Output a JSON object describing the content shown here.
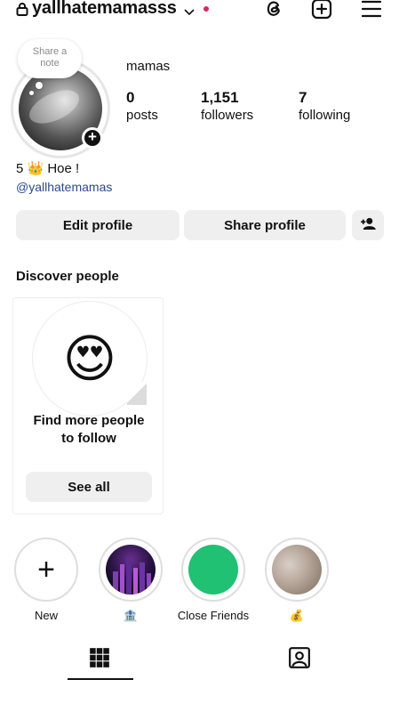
{
  "header": {
    "username": "yallhatemamasss",
    "icons": [
      "lock-icon",
      "chevron-down-icon",
      "threads-icon",
      "new-post-icon",
      "menu-icon"
    ],
    "notification_dot_color": "#e0245e"
  },
  "profile": {
    "note_placeholder_line1": "Share a",
    "note_placeholder_line2": "note",
    "display_name": "mamas",
    "stats": [
      {
        "number": "0",
        "label": "posts"
      },
      {
        "number": "1,151",
        "label": "followers"
      },
      {
        "number": "7",
        "label": "following"
      }
    ],
    "bio": "5 👑 Hoe !",
    "handle_link": "@yallhatemamas"
  },
  "actions": {
    "edit_profile": "Edit profile",
    "share_profile": "Share profile",
    "add_person_icon": "add-person-icon"
  },
  "discover": {
    "title": "Discover people",
    "card_emoji": "😍",
    "card_text_line1": "Find more people",
    "card_text_line2": "to follow",
    "see_all": "See all"
  },
  "highlights": [
    {
      "label": "New",
      "type": "new"
    },
    {
      "label": "🏦",
      "type": "image-city"
    },
    {
      "label": "Close Friends",
      "type": "green",
      "color": "#20c173"
    },
    {
      "label": "💰",
      "type": "image-photo"
    }
  ],
  "tabs": [
    "grid-icon",
    "tagged-icon"
  ]
}
